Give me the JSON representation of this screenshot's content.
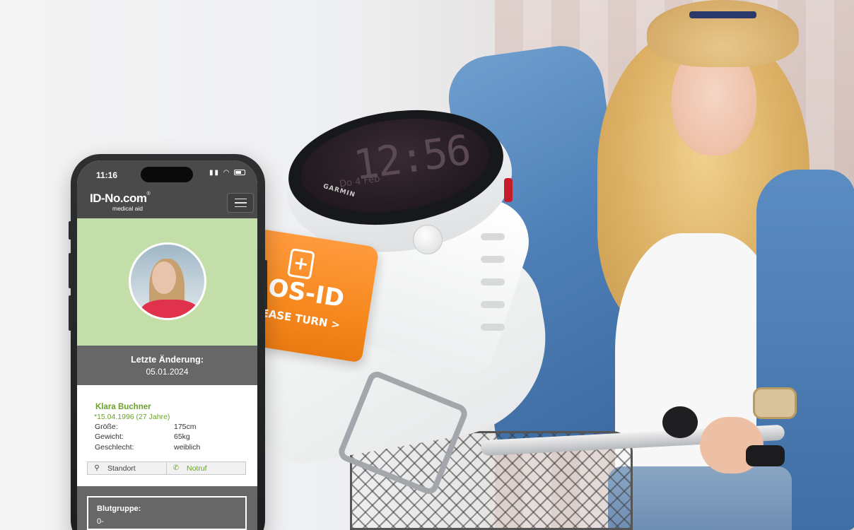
{
  "phone": {
    "status_time": "11:16",
    "logo": {
      "main": "ID-No.com",
      "registered": "®",
      "sub": "medical aid"
    },
    "menu_icon": "hamburger-menu-icon",
    "last_change_label": "Letzte Änderung:",
    "last_change_date": "05.01.2024",
    "person": {
      "name": "Klara Buchner",
      "birth": "*15.04.1996 (27 Jahre)",
      "rows": [
        {
          "label": "Größe:",
          "value": "175cm"
        },
        {
          "label": "Gewicht:",
          "value": "65kg"
        },
        {
          "label": "Geschlecht:",
          "value": "weiblich"
        }
      ]
    },
    "buttons": {
      "location_label": "Standort",
      "location_icon": "map-pin-icon",
      "emergency_label": "Notruf",
      "emergency_icon": "phone-icon"
    },
    "blood": {
      "label": "Blutgruppe:",
      "value": "0-"
    },
    "colors": {
      "accent_green": "#6ba02f",
      "profile_bg": "#c4deaa",
      "header_dark": "#4a4a4a"
    }
  },
  "watch": {
    "time": "12:56",
    "date": "Do 4 Feb",
    "brand": "GARMIN"
  },
  "sos_tag": {
    "cross": "+",
    "title": "SOS-ID",
    "subtitle": "PLEASE TURN >",
    "color": "#f6891f"
  }
}
